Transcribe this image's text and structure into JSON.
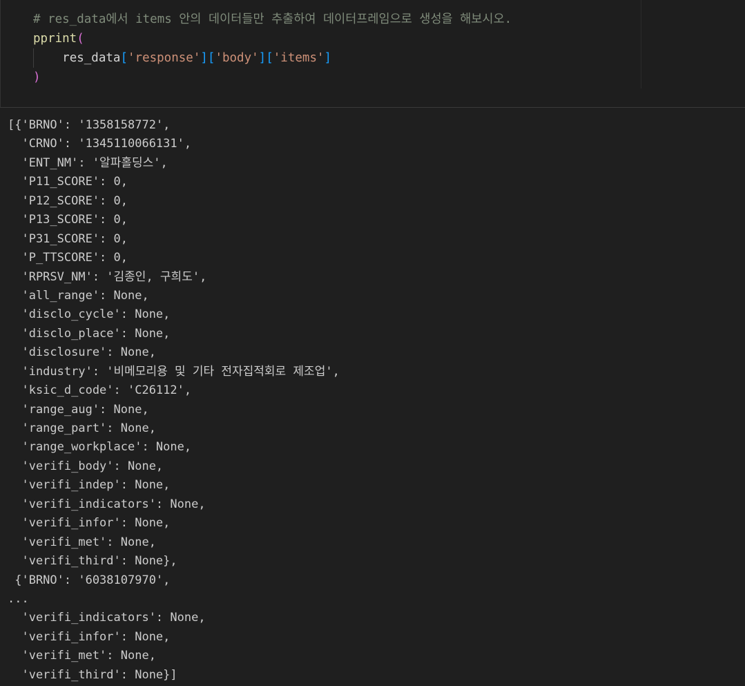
{
  "code_cell": {
    "comment": "# res_data에서 items 안의 데이터들만 추출하여 데이터프레임으로 생성을 해보시오.",
    "func_name": "pprint",
    "open_paren": "(",
    "close_paren": ")",
    "indent": "    ",
    "var_name": "res_data",
    "key1": "'response'",
    "key2": "'body'",
    "key3": "'items'",
    "bracket_open": "[",
    "bracket_close": "]"
  },
  "output": {
    "lines": [
      "[{'BRNO': '1358158772',",
      "  'CRNO': '1345110066131',",
      "  'ENT_NM': '알파홀딩스',",
      "  'P11_SCORE': 0,",
      "  'P12_SCORE': 0,",
      "  'P13_SCORE': 0,",
      "  'P31_SCORE': 0,",
      "  'P_TTSCORE': 0,",
      "  'RPRSV_NM': '김종인, 구희도',",
      "  'all_range': None,",
      "  'disclo_cycle': None,",
      "  'disclo_place': None,",
      "  'disclosure': None,",
      "  'industry': '비메모리용 및 기타 전자집적회로 제조업',",
      "  'ksic_d_code': 'C26112',",
      "  'range_aug': None,",
      "  'range_part': None,",
      "  'range_workplace': None,",
      "  'verifi_body': None,",
      "  'verifi_indep': None,",
      "  'verifi_indicators': None,",
      "  'verifi_infor': None,",
      "  'verifi_met': None,",
      "  'verifi_third': None},",
      " {'BRNO': '6038107970',",
      "...",
      "  'verifi_indicators': None,",
      "  'verifi_infor': None,",
      "  'verifi_met': None,",
      "  'verifi_third': None}]"
    ]
  }
}
